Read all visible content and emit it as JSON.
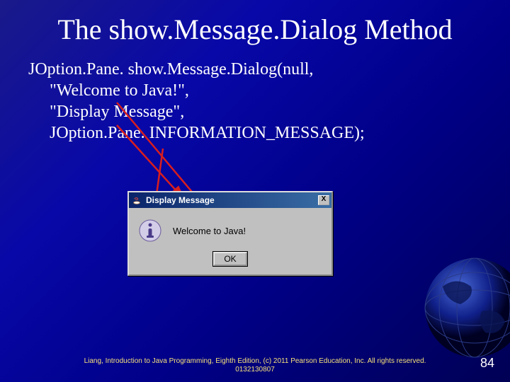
{
  "title": "The show.Message.Dialog Method",
  "code": {
    "line1": "JOption.Pane. show.Message.Dialog(null,",
    "line2": "\"Welcome to Java!\",",
    "line3": "\"Display Message\",",
    "line4": "JOption.Pane. INFORMATION_MESSAGE);"
  },
  "dialog": {
    "title": "Display Message",
    "message": "Welcome to Java!",
    "ok_label": "OK",
    "close_label": "X",
    "icon_name": "information-icon",
    "app_icon_name": "java-coffee-icon"
  },
  "footer": {
    "text": "Liang, Introduction to Java Programming, Eighth Edition, (c) 2011 Pearson Education, Inc. All rights reserved. 0132130807",
    "page": "84"
  }
}
